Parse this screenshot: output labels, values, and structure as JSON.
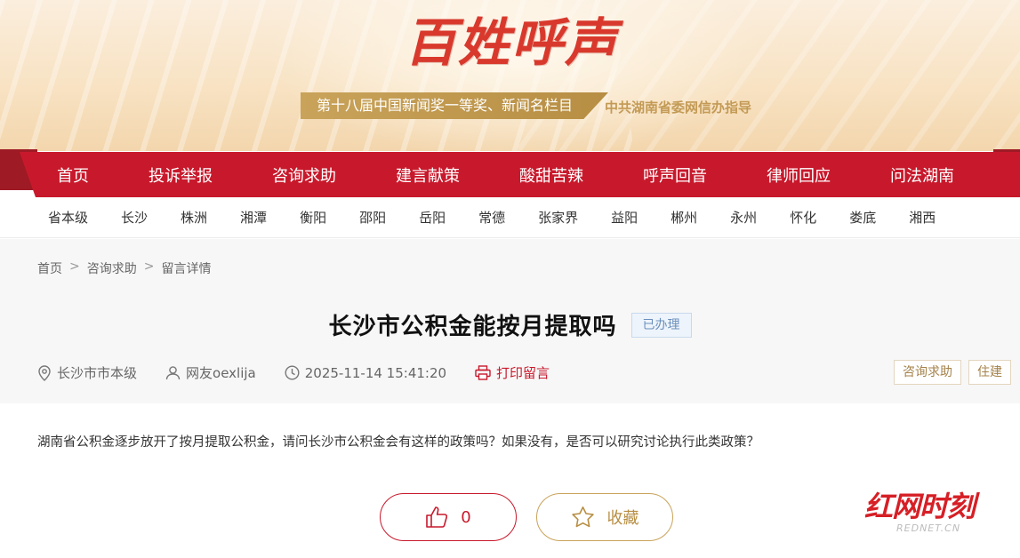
{
  "banner": {
    "title": "百姓呼声",
    "award": "第十八届中国新闻奖一等奖、新闻名栏目",
    "guide": "中共湖南省委网信办指导"
  },
  "nav": {
    "items": [
      "首页",
      "投诉举报",
      "咨询求助",
      "建言献策",
      "酸甜苦辣",
      "呼声回音",
      "律师回应",
      "问法湖南"
    ]
  },
  "regions": [
    "省本级",
    "长沙",
    "株洲",
    "湘潭",
    "衡阳",
    "邵阳",
    "岳阳",
    "常德",
    "张家界",
    "益阳",
    "郴州",
    "永州",
    "怀化",
    "娄底",
    "湘西"
  ],
  "breadcrumb": [
    "首页",
    "咨询求助",
    "留言详情"
  ],
  "breadcrumb_sep": ">",
  "post": {
    "title": "长沙市公积金能按月提取吗",
    "status": "已办理",
    "location": "长沙市市本级",
    "author": "网友oexlija",
    "time": "2025-11-14 15:41:20",
    "print_label": "打印留言",
    "tags": [
      "咨询求助",
      "住建"
    ],
    "content": "湖南省公积金逐步放开了按月提取公积金，请问长沙市公积金会有这样的政策吗？如果没有，是否可以研究讨论执行此类政策？",
    "like_count": "0",
    "favorite_label": "收藏"
  },
  "watermark": {
    "main": "红网时刻",
    "sub": "REDNET.CN"
  },
  "colors": {
    "brand_red": "#c8192c",
    "gold": "#b78e43",
    "status_blue": "#6b8fbd"
  },
  "icons": {
    "location": "location-pin-icon",
    "user": "user-icon",
    "clock": "clock-icon",
    "print": "printer-icon",
    "like": "thumbs-up-icon",
    "favorite": "star-icon"
  }
}
